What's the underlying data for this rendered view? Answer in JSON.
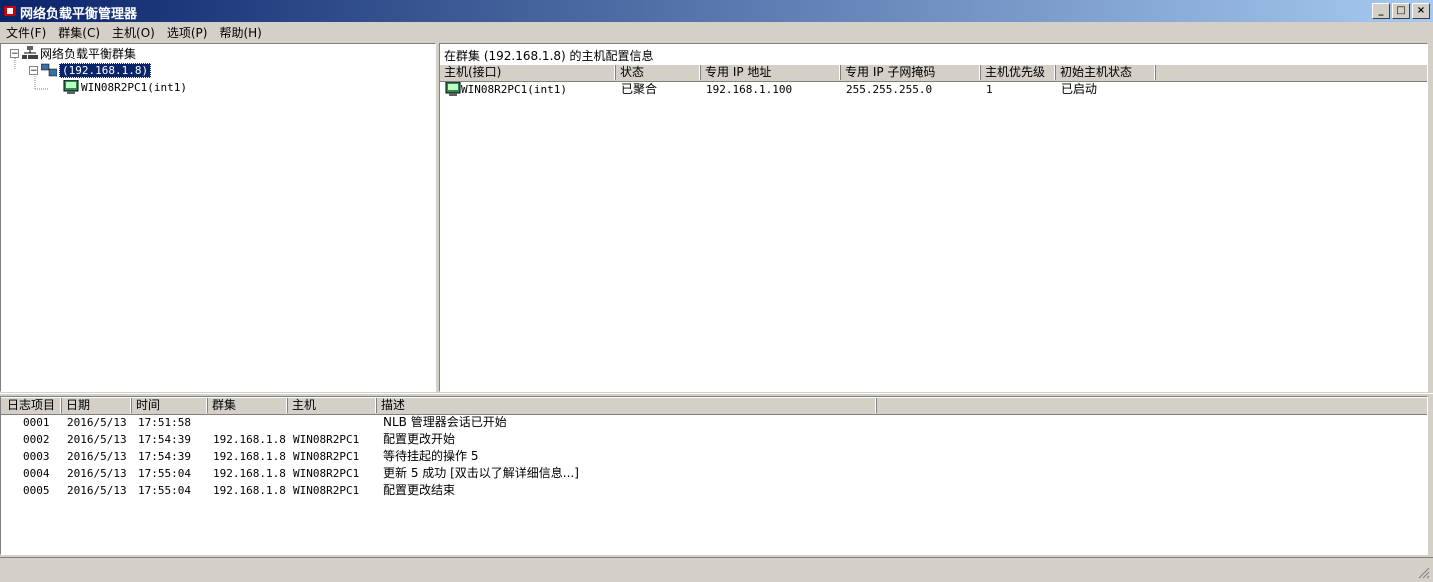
{
  "window": {
    "title": "网络负载平衡管理器",
    "min_label": "_",
    "max_label": "□",
    "close_label": "×"
  },
  "menu": [
    "文件(F)",
    "群集(C)",
    "主机(O)",
    "选项(P)",
    "帮助(H)"
  ],
  "tree": {
    "root_label": "网络负载平衡群集",
    "cluster_label": "(192.168.1.8)",
    "host_label": "WIN08R2PC1(int1)"
  },
  "detail": {
    "header": "在群集  (192.168.1.8) 的主机配置信息",
    "columns": [
      "主机(接口)",
      "状态",
      "专用 IP 地址",
      "专用 IP 子网掩码",
      "主机优先级",
      "初始主机状态"
    ],
    "rows": [
      {
        "host": "WIN08R2PC1(int1)",
        "status": "已聚合",
        "ip": "192.168.1.100",
        "mask": "255.255.255.0",
        "priority": "1",
        "initial_state": "已启动"
      }
    ]
  },
  "log": {
    "columns": [
      "日志项目",
      "日期",
      "时间",
      "群集",
      "主机",
      "描述"
    ],
    "rows": [
      {
        "id": "0001",
        "date": "2016/5/13",
        "time": "17:51:58",
        "cluster": "",
        "host": "",
        "desc": "NLB 管理器会话已开始"
      },
      {
        "id": "0002",
        "date": "2016/5/13",
        "time": "17:54:39",
        "cluster": "192.168.1.8",
        "host": "WIN08R2PC1",
        "desc": "配置更改开始"
      },
      {
        "id": "0003",
        "date": "2016/5/13",
        "time": "17:54:39",
        "cluster": "192.168.1.8",
        "host": "WIN08R2PC1",
        "desc": "等待挂起的操作 5"
      },
      {
        "id": "0004",
        "date": "2016/5/13",
        "time": "17:55:04",
        "cluster": "192.168.1.8",
        "host": "WIN08R2PC1",
        "desc": "更新 5 成功 [双击以了解详细信息...]"
      },
      {
        "id": "0005",
        "date": "2016/5/13",
        "time": "17:55:04",
        "cluster": "192.168.1.8",
        "host": "WIN08R2PC1",
        "desc": "配置更改结束"
      }
    ]
  },
  "colors": {
    "titlebar_start": "#0a246a",
    "titlebar_end": "#a6caf0",
    "selection": "#0a246a",
    "chrome": "#d4d0c8"
  }
}
